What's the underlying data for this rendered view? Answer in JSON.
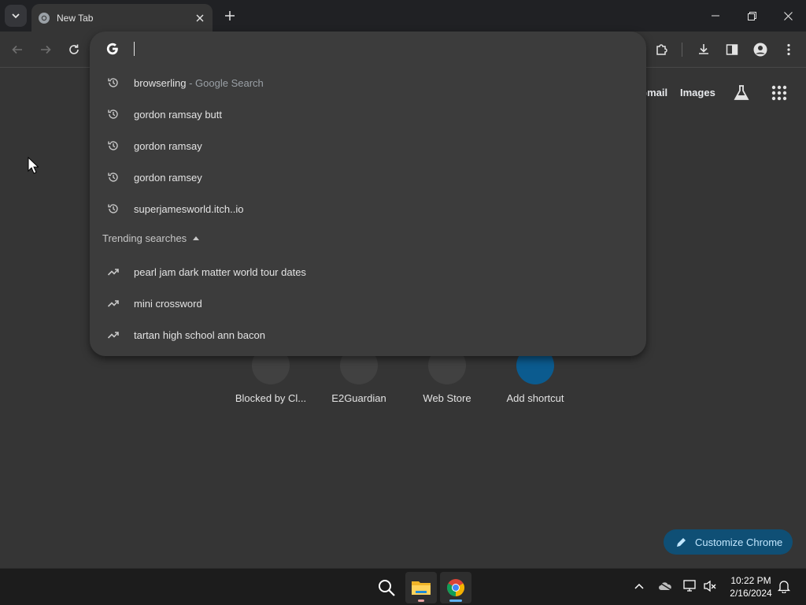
{
  "browser": {
    "tab": {
      "title": "New Tab"
    }
  },
  "ntp": {
    "links": {
      "gmail": "Gmail",
      "images": "Images"
    },
    "shortcuts": [
      {
        "label": "Blocked by Cl..."
      },
      {
        "label": "E2Guardian"
      },
      {
        "label": "Web Store"
      },
      {
        "label": "Add shortcut"
      }
    ],
    "customize_label": "Customize Chrome"
  },
  "omnibox": {
    "value": "",
    "history": [
      {
        "text": "browserling",
        "suffix": " - Google Search"
      },
      {
        "text": "gordon ramsay butt",
        "suffix": ""
      },
      {
        "text": "gordon ramsay",
        "suffix": ""
      },
      {
        "text": "gordon ramsey",
        "suffix": ""
      },
      {
        "text": "superjamesworld.itch..io",
        "suffix": ""
      }
    ],
    "trending_header": "Trending searches",
    "trending": [
      {
        "text": "pearl jam dark matter world tour dates"
      },
      {
        "text": "mini crossword"
      },
      {
        "text": "tartan high school ann bacon"
      }
    ]
  },
  "taskbar": {
    "time": "10:22 PM",
    "date": "2/16/2024"
  },
  "colors": {
    "frame": "#202124",
    "toolbar": "#353535",
    "dropdown": "#3c3c3c",
    "accent": "#0f4f75",
    "taskbar": "#1c1c1c"
  },
  "icons": [
    "chevron-down-icon",
    "chrome-icon",
    "close-icon",
    "plus-icon",
    "minimize-icon",
    "restore-icon",
    "back-icon",
    "forward-icon",
    "reload-icon",
    "google-g-icon",
    "history-icon",
    "trending-icon",
    "caret-up-icon",
    "extensions-icon",
    "download-icon",
    "side-panel-icon",
    "profile-icon",
    "more-icon",
    "labs-icon",
    "apps-grid-icon",
    "pencil-icon",
    "search-icon",
    "folder-icon",
    "onedrive-icon",
    "network-icon",
    "volume-icon",
    "bell-icon"
  ]
}
